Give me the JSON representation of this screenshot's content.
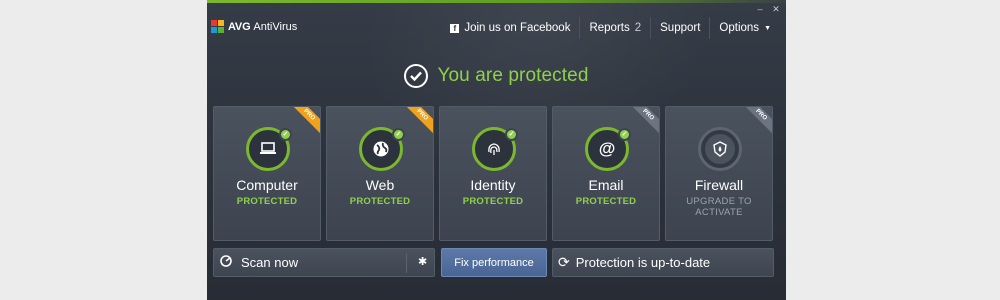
{
  "app": {
    "brand": "AVG",
    "product": "AntiVirus"
  },
  "window_controls": {
    "minimize": "–",
    "close": "✕"
  },
  "topnav": {
    "facebook": {
      "icon": "facebook-icon",
      "label": "Join us on Facebook"
    },
    "reports": {
      "label": "Reports",
      "count": "2"
    },
    "support": {
      "label": "Support"
    },
    "options": {
      "label": "Options",
      "caret": "▼"
    }
  },
  "hero": {
    "icon": "checkmark-circle-icon",
    "title": "You are protected"
  },
  "tiles": [
    {
      "name": "Computer",
      "status": "PROTECTED",
      "ribbon": "PRO",
      "icon": "laptop-icon",
      "glyph": "▭"
    },
    {
      "name": "Web",
      "status": "PROTECTED",
      "ribbon": "PRO",
      "icon": "globe-icon",
      "glyph": "◕"
    },
    {
      "name": "Identity",
      "status": "PROTECTED",
      "ribbon": "",
      "icon": "fingerprint-icon",
      "glyph": "◎"
    },
    {
      "name": "Email",
      "status": "PROTECTED",
      "ribbon": "PRO",
      "icon": "at-sign-icon",
      "glyph": "@"
    },
    {
      "name": "Firewall",
      "status": "UPGRADE TO ACTIVATE",
      "ribbon": "PRO",
      "icon": "flame-shield-icon",
      "glyph": "🔥"
    }
  ],
  "bottom": {
    "scan": {
      "label": "Scan now",
      "icon": "radar-icon",
      "settings_icon": "gear-icon",
      "settings_glyph": "✱"
    },
    "fix": {
      "label": "Fix performance"
    },
    "update": {
      "label": "Protection is up-to-date",
      "icon": "refresh-icon",
      "glyph": "⟳"
    }
  },
  "colors": {
    "accent_green": "#8fd14a",
    "ribbon_orange": "#f0a21c",
    "ribbon_gray": "#6b7480",
    "fix_blue": "#4f6b9c",
    "window_bg": "#2f353f"
  }
}
